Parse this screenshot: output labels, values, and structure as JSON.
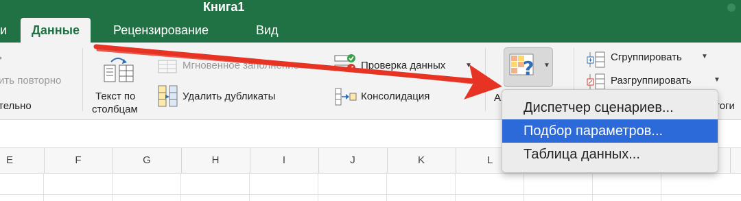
{
  "window": {
    "title": "Книга1"
  },
  "tabs": [
    {
      "label": "и"
    },
    {
      "label": "Данные",
      "active": true
    },
    {
      "label": "Рецензирование"
    },
    {
      "label": "Вид"
    }
  ],
  "ribbon": {
    "partial": {
      "line1": "ить повторно",
      "line2": "тельно"
    },
    "text_to_columns": {
      "line1": "Текст по",
      "line2": "столбцам"
    },
    "flash_fill": "Мгновенное заполнение",
    "remove_duplicates": "Удалить дубликаты",
    "data_validation": "Проверка данных",
    "consolidate": "Консолидация",
    "what_if_partial": "А",
    "group": "Сгруппировать",
    "ungroup": "Разгруппировать",
    "subtotal_partial": "тоги"
  },
  "what_if_menu": {
    "items": [
      {
        "label": "Диспетчер сценариев...",
        "highlighted": false
      },
      {
        "label": "Подбор параметров...",
        "highlighted": true
      },
      {
        "label": "Таблица данных...",
        "highlighted": false
      }
    ]
  },
  "grid": {
    "columns": [
      "E",
      "F",
      "G",
      "H",
      "I",
      "J",
      "K",
      "L"
    ]
  },
  "colors": {
    "excel_green": "#207245",
    "highlight_blue": "#2b6ad8",
    "annotation_red": "#e63323"
  },
  "icons": {
    "what_if": "what-if-analysis-icon",
    "text_to_columns": "text-to-columns-icon",
    "remove_duplicates": "remove-duplicates-icon",
    "data_validation": "data-validation-icon",
    "consolidate": "consolidate-icon",
    "group": "group-icon",
    "ungroup": "ungroup-icon",
    "annotation": "red-arrow-annotation"
  }
}
